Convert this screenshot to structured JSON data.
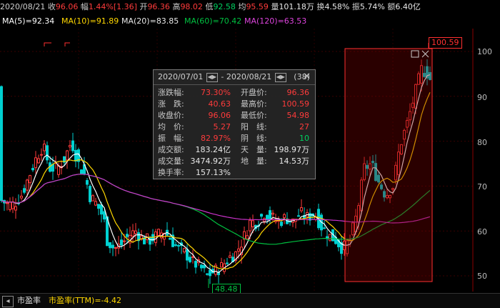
{
  "quote": {
    "date": "2020/08/21",
    "close_label": "收",
    "close": "96.06",
    "change_label": "幅",
    "change": "1.44%[1.36]",
    "open_label": "开",
    "open": "96.36",
    "high_label": "高",
    "high": "98.02",
    "low_label": "低",
    "low": "92.58",
    "avg_label": "均",
    "avg": "95.59",
    "volume_label": "量",
    "volume": "101.18万",
    "turnover_label": "换",
    "turnover": "4.58%",
    "amplitude_label": "振",
    "amplitude": "5.74%",
    "amount_label": "额",
    "amount": "6.40亿"
  },
  "ma": {
    "ma5": "MA(5)=92.34",
    "ma10": "MA(10)=91.89",
    "ma20": "MA(20)=83.85",
    "ma60": "MA(60)=70.42",
    "ma120": "MA(120)=63.53"
  },
  "colors": {
    "up": "#ff3b3b",
    "down": "#00d0d0",
    "ma5": "#ffffff",
    "ma10": "#ffd700",
    "ma20": "#ff44ff",
    "ma60": "#00c040",
    "ma120": "#cc33cc",
    "grid": "#3a0000"
  },
  "axis": {
    "ticks": [
      "100",
      "90",
      "80",
      "70",
      "60",
      "50"
    ]
  },
  "tags": {
    "high_price": "100.59",
    "low_price": "48.48"
  },
  "panel": {
    "range_start": "2020/07/01",
    "range_sep": "-",
    "range_end": "2020/08/21",
    "count": "(38)",
    "rows": [
      {
        "l1": "涨跌幅:",
        "v1": "73.30%",
        "c1": "r",
        "l2": "开盘价:",
        "v2": "96.36",
        "c2": "r"
      },
      {
        "l1": "涨　跌:",
        "v1": "40.63",
        "c1": "r",
        "l2": "最高价:",
        "v2": "100.59",
        "c2": "r"
      },
      {
        "l1": "收盘价:",
        "v1": "96.06",
        "c1": "r",
        "l2": "最低价:",
        "v2": "54.98",
        "c2": "r"
      },
      {
        "l1": "均　价:",
        "v1": "5.27",
        "c1": "r",
        "l2": "阳　线:",
        "v2": "27",
        "c2": "r"
      },
      {
        "l1": "振　幅:",
        "v1": "82.97%",
        "c1": "r",
        "l2": "阴　线:",
        "v2": "10",
        "c2": "g"
      },
      {
        "l1": "成交额:",
        "v1": "183.24亿",
        "c1": "w",
        "l2": "天　量:",
        "v2": "198.97万",
        "c2": "w"
      },
      {
        "l1": "成交量:",
        "v1": "3474.92万",
        "c1": "w",
        "l2": "地　量:",
        "v2": "14.53万",
        "c2": "w"
      },
      {
        "l1": "换手率:",
        "v1": "157.13%",
        "c1": "w",
        "l2": "",
        "v2": "",
        "c2": "w"
      }
    ]
  },
  "bottom": {
    "tab": "市盈率",
    "pe": "市盈率(TTM)=-4.42"
  }
}
